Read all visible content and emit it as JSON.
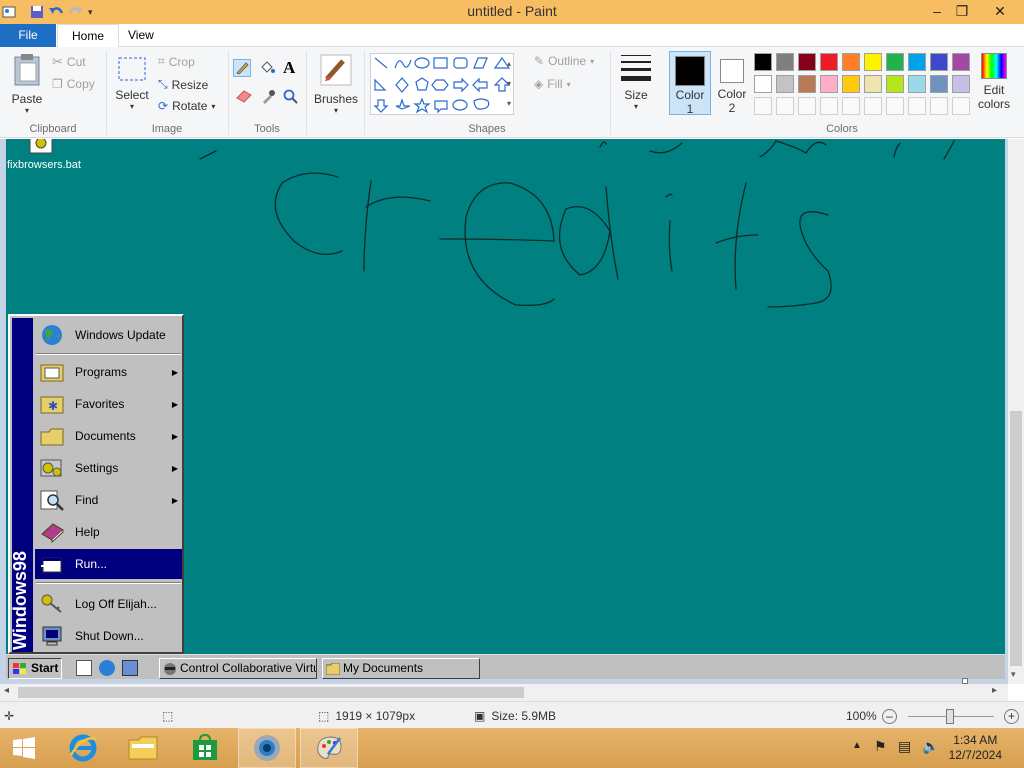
{
  "window": {
    "title": "untitled - Paint"
  },
  "tabs": {
    "file": "File",
    "home": "Home",
    "view": "View"
  },
  "ribbon": {
    "clipboard": {
      "paste": "Paste",
      "cut": "Cut",
      "copy": "Copy",
      "label": "Clipboard"
    },
    "image": {
      "select": "Select",
      "crop": "Crop",
      "resize": "Resize",
      "rotate": "Rotate",
      "label": "Image"
    },
    "tools": {
      "label": "Tools"
    },
    "brushes": {
      "label": "Brushes"
    },
    "shapes": {
      "outline": "Outline",
      "fill": "Fill",
      "label": "Shapes"
    },
    "size": {
      "label": "Size"
    },
    "color1": {
      "line1": "Color",
      "line2": "1"
    },
    "color2": {
      "line1": "Color",
      "line2": "2"
    },
    "colors": {
      "label": "Colors"
    },
    "edit_colors": {
      "line1": "Edit",
      "line2": "colors"
    }
  },
  "palette": {
    "row1": [
      "#000000",
      "#7f7f7f",
      "#880015",
      "#ed1c24",
      "#ff7f27",
      "#fff200",
      "#22b14c",
      "#00a2e8",
      "#3f48cc",
      "#a349a4"
    ],
    "row2": [
      "#ffffff",
      "#c3c3c3",
      "#b97a57",
      "#ffaec9",
      "#ffc90e",
      "#efe4b0",
      "#b5e61d",
      "#99d9ea",
      "#7092be",
      "#c8bfe7"
    ]
  },
  "canvas": {
    "background": "#008080",
    "desktop_icon": "fixbrowsers.bat",
    "drawn_text": "credits"
  },
  "startmenu": {
    "banner": "Windows98",
    "items": [
      {
        "label": "Windows Update"
      },
      {
        "label": "Programs"
      },
      {
        "label": "Favorites"
      },
      {
        "label": "Documents"
      },
      {
        "label": "Settings"
      },
      {
        "label": "Find"
      },
      {
        "label": "Help"
      },
      {
        "label": "Run..."
      },
      {
        "label": "Log Off Elijah..."
      },
      {
        "label": "Shut Down..."
      }
    ]
  },
  "taskbar98": {
    "start": "Start",
    "tasks": [
      "Control Collaborative Virtua...",
      "My Documents"
    ]
  },
  "statusbar": {
    "dimensions": "1919 × 1079px",
    "size": "Size: 5.9MB",
    "zoom": "100%"
  },
  "clock": {
    "time": "1:34 AM",
    "date": "12/7/2024"
  }
}
